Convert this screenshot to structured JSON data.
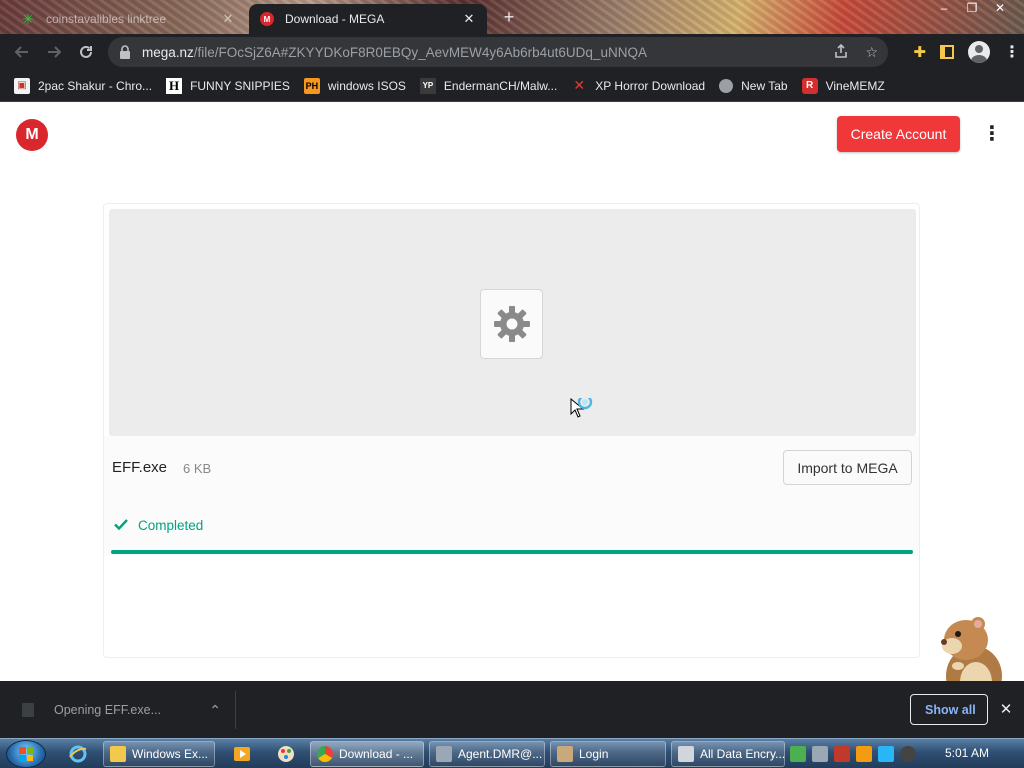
{
  "browser": {
    "tabs": [
      {
        "title": "coinstavalibles linktree",
        "active": false
      },
      {
        "title": "Download - MEGA",
        "active": true
      }
    ],
    "url": {
      "host": "mega.nz",
      "path": "/file/FOcSjZ6A#ZKYYDKoF8R0EBQy_AevMEW4y6Ab6rb4ut6UDq_uNNQA"
    },
    "bookmarks": [
      {
        "label": "2pac Shakur - Chro...",
        "icon": "extension-icon"
      },
      {
        "label": "FUNNY SNIPPIES",
        "icon": "h-icon"
      },
      {
        "label": "windows ISOS",
        "icon": "ph-icon"
      },
      {
        "label": "EndermanCH/Malw...",
        "icon": "yp-icon"
      },
      {
        "label": "XP Horror Download",
        "icon": "x-icon"
      },
      {
        "label": "New Tab",
        "icon": "globe-icon"
      },
      {
        "label": "VineMEMZ",
        "icon": "r-icon"
      }
    ]
  },
  "page": {
    "create_account_label": "Create Account",
    "file": {
      "name": "EFF.exe",
      "size": "6 KB",
      "import_label": "Import to MEGA",
      "status": "Completed",
      "progress_percent": 100
    }
  },
  "downloads_shelf": {
    "item_label": "Opening EFF.exe...",
    "show_all_label": "Show all"
  },
  "taskbar": {
    "tasks": [
      {
        "label": "Windows Ex..."
      },
      {
        "label": "Download - ..."
      },
      {
        "label": "Agent.DMR@..."
      },
      {
        "label": "Login"
      },
      {
        "label": "All Data Encry..."
      }
    ],
    "clock": "5:01 AM"
  },
  "colors": {
    "mega_red": "#d9272e",
    "create_button": "#f0373a",
    "success_green": "#00a382",
    "chrome_dark": "#202124"
  }
}
